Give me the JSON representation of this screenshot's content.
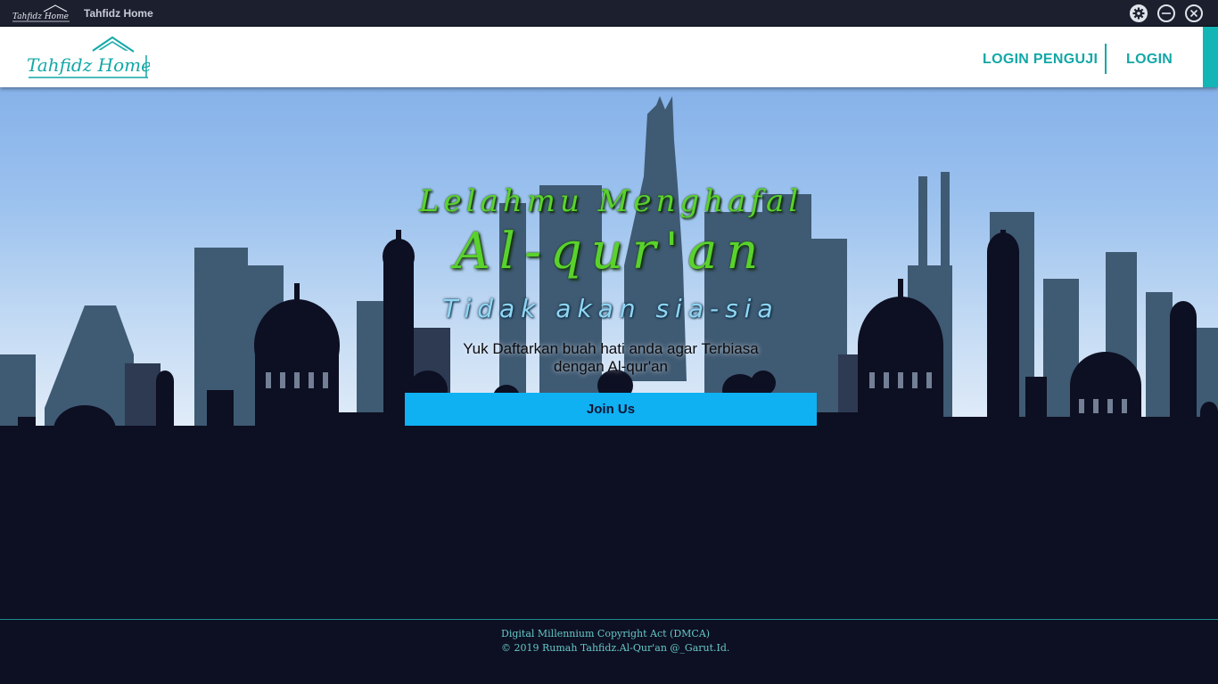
{
  "window": {
    "title": "Tahfidz Home",
    "logo_text": "Tahfidz Home"
  },
  "nav": {
    "logo_text": "Tahfidz Home",
    "links": [
      "LOGIN PENGUJI",
      "LOGIN"
    ]
  },
  "hero": {
    "headline_line1": "Lelahmu Menghafal",
    "headline_line2": "Al-qur'an",
    "tagline": "Tidak akan sia-sia",
    "subtext_line1": "Yuk Daftarkan buah hati anda agar Terbiasa",
    "subtext_line2": "dengan Al-qur'an",
    "join_button": "Join Us"
  },
  "footer": {
    "line1": "Digital Millennium Copyright Act (DMCA)",
    "line2": "© 2019 Rumah Tahfidz.Al-Qur'an @_Garut.Id."
  },
  "colors": {
    "accent": "#14a7a7",
    "button": "#0fb1f3",
    "headline": "#5ad22c",
    "tagline": "#8fd6f4",
    "dark": "#0d0f22"
  },
  "icons": [
    "settings-icon",
    "minimize-icon",
    "close-icon"
  ]
}
